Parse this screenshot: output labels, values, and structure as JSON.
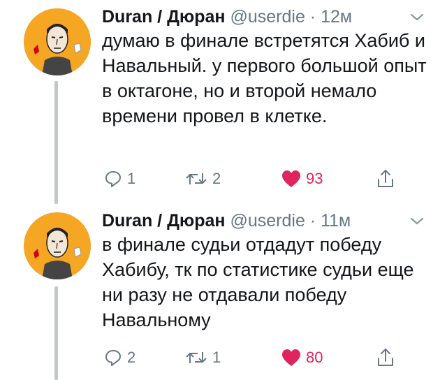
{
  "tweets": [
    {
      "author_name": "Duran / Дюран",
      "handle": "@userdie",
      "separator": "·",
      "time": "12м",
      "text": "думаю в финале встретятся Хабиб и Навальный. у первого большой опыт в октагоне, но и второй немало времени провел в клетке.",
      "replies": "1",
      "retweets": "2",
      "likes": "93",
      "liked": true
    },
    {
      "author_name": "Duran / Дюран",
      "handle": "@userdie",
      "separator": "·",
      "time": "11м",
      "text": "в финале судьи отдадут победу Хабибу, тк по статистике судьи еще ни разу не отдавали победу Навальному",
      "replies": "2",
      "retweets": "1",
      "likes": "80",
      "liked": true
    }
  ],
  "colors": {
    "accent_like": "#e0245e",
    "secondary_text": "#657786",
    "avatar_bg": "#f5a623"
  },
  "icons": {
    "reply": "reply-icon",
    "retweet": "retweet-icon",
    "like": "heart-icon",
    "share": "share-icon",
    "menu": "chevron-down-icon"
  }
}
